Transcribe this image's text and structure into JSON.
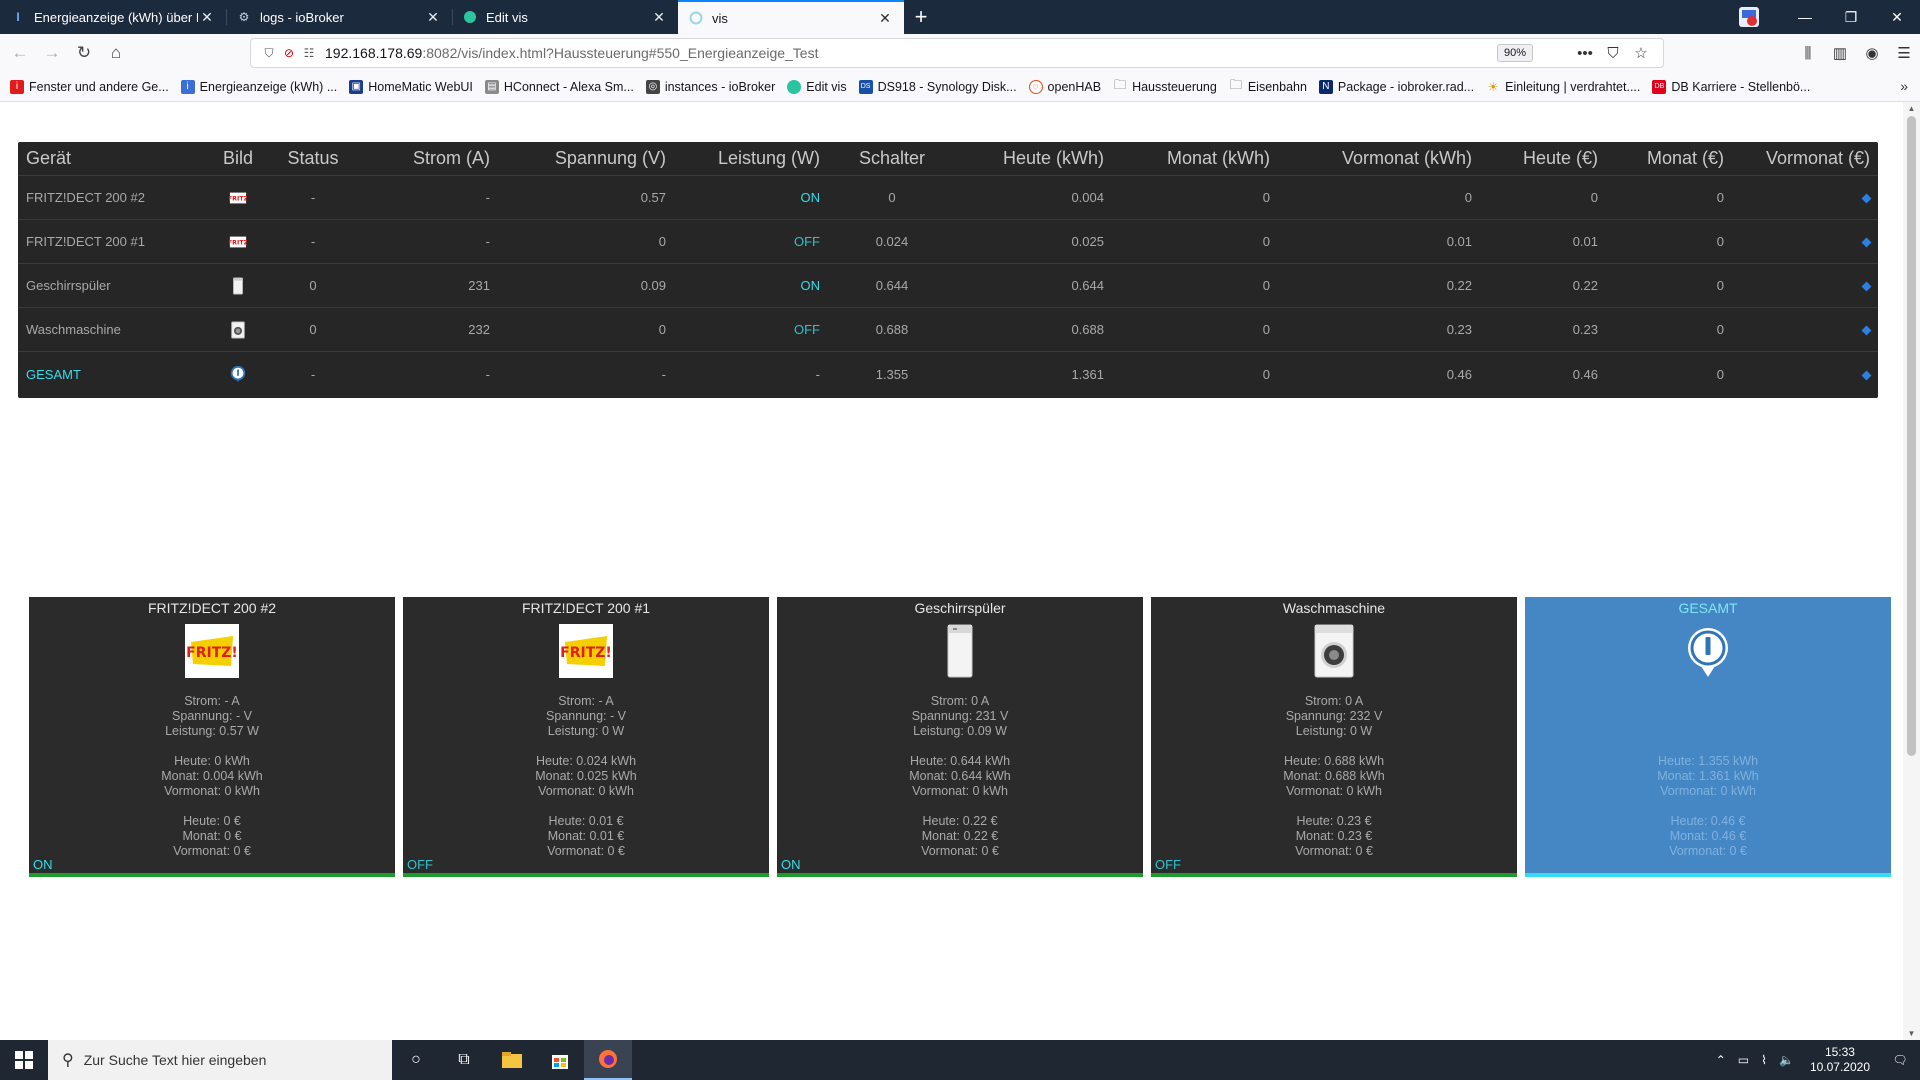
{
  "browser": {
    "tabs": [
      {
        "title": "Energieanzeige (kWh) über HT",
        "active": false
      },
      {
        "title": "logs - ioBroker",
        "active": false
      },
      {
        "title": "Edit vis",
        "active": false
      },
      {
        "title": "vis",
        "active": true
      }
    ],
    "url_host": "192.168.178.69",
    "url_path": ":8082/vis/index.html?Haussteuerung#550_Energieanzeige_Test",
    "zoom": "90%",
    "bookmarks": [
      "Fenster und andere Ge...",
      "Energieanzeige (kWh) ...",
      "HomeMatic WebUI",
      "HConnect - Alexa Sm...",
      "instances - ioBroker",
      "Edit vis",
      "DS918 - Synology Disk...",
      "openHAB",
      "Haussteuerung",
      "Eisenbahn",
      "Package - iobroker.rad...",
      "Einleitung | verdrahtet....",
      "DB Karriere - Stellenbö..."
    ]
  },
  "table": {
    "headers": [
      "Gerät",
      "Bild",
      "Status",
      "Strom (A)",
      "Spannung (V)",
      "Leistung (W)",
      "Schalter",
      "Heute (kWh)",
      "Monat (kWh)",
      "Vormonat (kWh)",
      "Heute (€)",
      "Monat (€)",
      "Vormonat (€)"
    ],
    "rows": [
      {
        "device": "FRITZ!DECT 200 #2",
        "status": "-",
        "strom": "-",
        "spannung": "0.57",
        "leistung": "ON",
        "schalter": "0",
        "heute_kwh": "0.004",
        "monat_kwh": "0",
        "vormonat_kwh": "0",
        "heute_eur": "0",
        "monat_eur": "0",
        "icon": "fritz-icon"
      },
      {
        "device": "FRITZ!DECT 200 #1",
        "status": "-",
        "strom": "-",
        "spannung": "0",
        "leistung": "OFF",
        "schalter": "0.024",
        "heute_kwh": "0.025",
        "monat_kwh": "0",
        "vormonat_kwh": "0.01",
        "heute_eur": "0.01",
        "monat_eur": "0",
        "icon": "fritz-icon"
      },
      {
        "device": "Geschirrspüler",
        "status": "0",
        "strom": "231",
        "spannung": "0.09",
        "leistung": "ON",
        "schalter": "0.644",
        "heute_kwh": "0.644",
        "monat_kwh": "0",
        "vormonat_kwh": "0.22",
        "heute_eur": "0.22",
        "monat_eur": "0",
        "icon": "dishwasher-icon"
      },
      {
        "device": "Waschmaschine",
        "status": "0",
        "strom": "232",
        "spannung": "0",
        "leistung": "OFF",
        "schalter": "0.688",
        "heute_kwh": "0.688",
        "monat_kwh": "0",
        "vormonat_kwh": "0.23",
        "heute_eur": "0.23",
        "monat_eur": "0",
        "icon": "washing-machine-icon"
      },
      {
        "device": "GESAMT",
        "status": "-",
        "strom": "-",
        "spannung": "-",
        "leistung": "-",
        "schalter": "1.355",
        "heute_kwh": "1.361",
        "monat_kwh": "0",
        "vormonat_kwh": "0.46",
        "heute_eur": "0.46",
        "monat_eur": "0",
        "icon": "info-icon"
      }
    ]
  },
  "cards": [
    {
      "title": "FRITZ!DECT 200 #2",
      "strom": "Strom: - A",
      "spannung": "Spannung: - V",
      "leistung": "Leistung: 0.57 W",
      "heute_kwh": "Heute: 0 kWh",
      "monat_kwh": "Monat: 0.004 kWh",
      "vormonat_kwh": "Vormonat: 0 kWh",
      "heute_eur": "Heute: 0 €",
      "monat_eur": "Monat: 0 €",
      "vormonat_eur": "Vormonat: 0 €",
      "state": "ON",
      "icon": "fritz-icon"
    },
    {
      "title": "FRITZ!DECT 200 #1",
      "strom": "Strom: - A",
      "spannung": "Spannung: - V",
      "leistung": "Leistung: 0 W",
      "heute_kwh": "Heute: 0.024 kWh",
      "monat_kwh": "Monat: 0.025 kWh",
      "vormonat_kwh": "Vormonat: 0 kWh",
      "heute_eur": "Heute: 0.01 €",
      "monat_eur": "Monat: 0.01 €",
      "vormonat_eur": "Vormonat: 0 €",
      "state": "OFF",
      "icon": "fritz-icon"
    },
    {
      "title": "Geschirrspüler",
      "strom": "Strom: 0 A",
      "spannung": "Spannung: 231 V",
      "leistung": "Leistung: 0.09 W",
      "heute_kwh": "Heute: 0.644 kWh",
      "monat_kwh": "Monat: 0.644 kWh",
      "vormonat_kwh": "Vormonat: 0 kWh",
      "heute_eur": "Heute: 0.22 €",
      "monat_eur": "Monat: 0.22 €",
      "vormonat_eur": "Vormonat: 0 €",
      "state": "ON",
      "icon": "dishwasher-icon"
    },
    {
      "title": "Waschmaschine",
      "strom": "Strom: 0 A",
      "spannung": "Spannung: 232 V",
      "leistung": "Leistung: 0 W",
      "heute_kwh": "Heute: 0.688 kWh",
      "monat_kwh": "Monat: 0.688 kWh",
      "vormonat_kwh": "Vormonat: 0 kWh",
      "heute_eur": "Heute: 0.23 €",
      "monat_eur": "Monat: 0.23 €",
      "vormonat_eur": "Vormonat: 0 €",
      "state": "OFF",
      "icon": "washing-machine-icon"
    },
    {
      "title": "GESAMT",
      "strom": "",
      "spannung": "",
      "leistung": "",
      "heute_kwh": "Heute: 1.355 kWh",
      "monat_kwh": "Monat: 1.361 kWh",
      "vormonat_kwh": "Vormonat: 0 kWh",
      "heute_eur": "Heute: 0.46 €",
      "monat_eur": "Monat: 0.46 €",
      "vormonat_eur": "Vormonat: 0 €",
      "state": "",
      "icon": "info-icon"
    }
  ],
  "taskbar": {
    "search_placeholder": "Zur Suche Text hier eingeben",
    "time": "15:33",
    "date": "10.07.2020"
  },
  "colors": {
    "accent_cyan": "#33ddee",
    "table_bg": "#262626",
    "card_bg": "#2b2b2b",
    "card_sum_bg": "#4587c4",
    "state_bar": "#1f9a2c"
  }
}
